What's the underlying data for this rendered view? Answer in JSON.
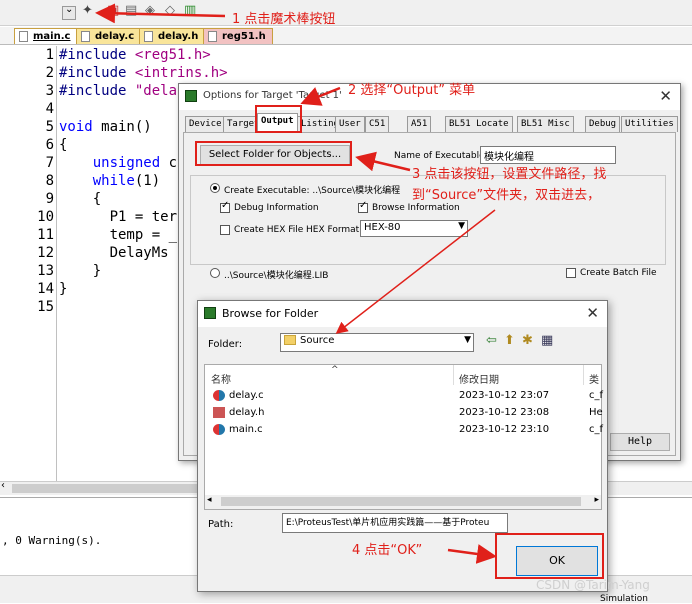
{
  "tabs": [
    {
      "label": "main.c",
      "bg": "#ffffff"
    },
    {
      "label": "delay.c",
      "bg": "#f9e59a"
    },
    {
      "label": "delay.h",
      "bg": "#f9e59a"
    },
    {
      "label": "reg51.h",
      "bg": "#f2c2c2"
    }
  ],
  "editor": {
    "line_numbers": [
      "1",
      "2",
      "3",
      "4",
      "5",
      "6",
      "7",
      "8",
      "9",
      "10",
      "11",
      "12",
      "13",
      "14",
      "15"
    ],
    "lines": [
      {
        "pre": "#include ",
        "str": "<reg51.h>"
      },
      {
        "pre": "#include ",
        "str": "<intrins.h>"
      },
      {
        "pre": "#include ",
        "str": "\"dela"
      },
      {
        "pre": "",
        "str": ""
      },
      {
        "kw": "void",
        "rest": " main()"
      },
      {
        "rest": "{"
      },
      {
        "indent": "    ",
        "kw": "unsigned",
        "rest": " c"
      },
      {
        "indent": "    ",
        "kw": "while",
        "rest": "(1)"
      },
      {
        "rest": "    {"
      },
      {
        "rest": "      P1 = ter"
      },
      {
        "rest": "      temp = _"
      },
      {
        "rest": "      DelayMs"
      },
      {
        "rest": "    }"
      },
      {
        "rest": "}"
      },
      {
        "rest": ""
      }
    ]
  },
  "build_output": ", 0 Warning(s).",
  "options_dialog": {
    "title": "Options for Target 'Target 1'",
    "close": "✕",
    "tabs": [
      "Device",
      "Target",
      "Output",
      "Listing",
      "User",
      "C51",
      "A51",
      "BL51 Locate",
      "BL51 Misc",
      "Debug",
      "Utilities"
    ],
    "active_tab": "Output",
    "select_folder_button": "Select Folder for Objects...",
    "name_label": "Name of Executable:",
    "name_value": "模块化编程",
    "create_exec_label": "Create Executable:  ..\\Source\\模块化编程",
    "debug_info": "Debug Information",
    "browse_info": "Browse Information",
    "create_hex": "Create HEX File",
    "hex_format_label": "HEX Format:",
    "hex_format_value": "HEX-80",
    "lib_label": "..\\Source\\模块化编程.LIB",
    "create_batch": "Create Batch File",
    "help_button": "Help"
  },
  "browse_dialog": {
    "title": "Browse for Folder",
    "close": "✕",
    "folder_label": "Folder:",
    "folder_value": "Source",
    "columns": [
      "名称",
      "修改日期",
      "类"
    ],
    "files": [
      {
        "name": "delay.c",
        "date": "2023-10-12 23:07",
        "type": "c_f"
      },
      {
        "name": "delay.h",
        "date": "2023-10-12 23:08",
        "type": "He"
      },
      {
        "name": "main.c",
        "date": "2023-10-12 23:10",
        "type": "c_f"
      }
    ],
    "path_label": "Path:",
    "path_value": "E:\\ProteusTest\\单片机应用实践篇——基于Proteu",
    "ok_button": "OK"
  },
  "annotations": {
    "step1": "1  点击魔术棒按钮",
    "step2": "2  选择“Output” 菜单",
    "step3a": "3 点击该按钮，设置文件路径，找",
    "step3b": "到“Source”文件夹，双击进去，",
    "step4": "4 点击“OK”"
  },
  "status": {
    "simulation": "Simulation"
  },
  "watermark": "CSDN @Tarim-Yang",
  "colors": {
    "annotation": "#e0201a"
  }
}
